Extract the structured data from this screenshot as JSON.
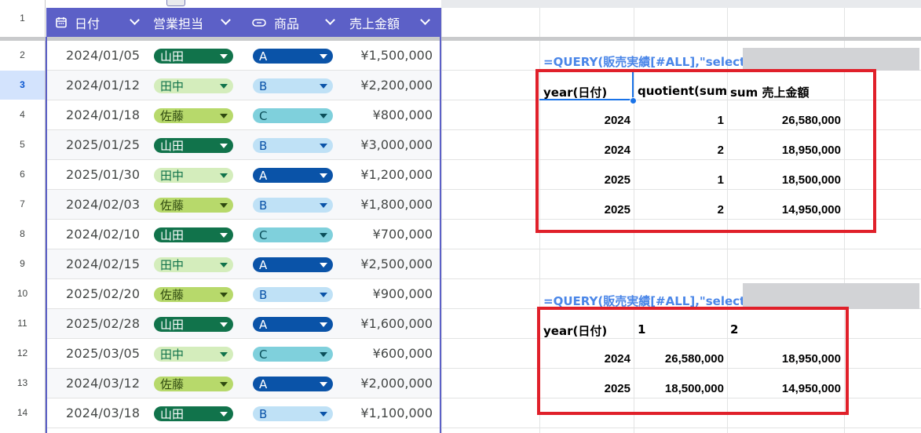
{
  "columns": [
    {
      "label": "日付",
      "icon": "calendar-icon"
    },
    {
      "label": "営業担当"
    },
    {
      "label": "商品",
      "icon": "chip-icon"
    },
    {
      "label": "売上金額"
    }
  ],
  "row_numbers": [
    "1",
    "2",
    "3",
    "4",
    "5",
    "6",
    "7",
    "8",
    "9",
    "10",
    "11",
    "12",
    "13",
    "14"
  ],
  "active_row": "3",
  "rows": [
    {
      "date": "2024/01/05",
      "person": "山田",
      "product": "A",
      "amount": "¥1,500,000"
    },
    {
      "date": "2024/01/12",
      "person": "田中",
      "product": "B",
      "amount": "¥2,200,000"
    },
    {
      "date": "2024/01/18",
      "person": "佐藤",
      "product": "C",
      "amount": "¥800,000"
    },
    {
      "date": "2025/01/25",
      "person": "山田",
      "product": "B",
      "amount": "¥3,000,000"
    },
    {
      "date": "2025/01/30",
      "person": "田中",
      "product": "A",
      "amount": "¥1,200,000"
    },
    {
      "date": "2024/02/03",
      "person": "佐藤",
      "product": "B",
      "amount": "¥1,800,000"
    },
    {
      "date": "2024/02/10",
      "person": "山田",
      "product": "C",
      "amount": "¥700,000"
    },
    {
      "date": "2024/02/15",
      "person": "田中",
      "product": "A",
      "amount": "¥2,500,000"
    },
    {
      "date": "2025/02/20",
      "person": "佐藤",
      "product": "B",
      "amount": "¥900,000"
    },
    {
      "date": "2025/02/28",
      "person": "山田",
      "product": "A",
      "amount": "¥1,600,000"
    },
    {
      "date": "2025/03/05",
      "person": "田中",
      "product": "C",
      "amount": "¥600,000"
    },
    {
      "date": "2024/03/12",
      "person": "佐藤",
      "product": "A",
      "amount": "¥2,000,000"
    },
    {
      "date": "2024/03/18",
      "person": "山田",
      "product": "B",
      "amount": "¥1,100,000"
    }
  ],
  "chip_colors": {
    "山田": {
      "bg": "#11734b",
      "fg": "#ffffff"
    },
    "田中": {
      "bg": "#d4edbc",
      "fg": "#11734b"
    },
    "佐藤": {
      "bg": "#b7d96b",
      "fg": "#2f4a10"
    },
    "A": {
      "bg": "#0a53a8",
      "fg": "#ffffff"
    },
    "B": {
      "bg": "#bfe1f6",
      "fg": "#0a53a8"
    },
    "C": {
      "bg": "#7fd0dc",
      "fg": "#0b4f5a"
    }
  },
  "header_bg": "#5c60c7",
  "query1": {
    "formula": "=QUERY(販売実績[#ALL],\"select",
    "headers": [
      "year(日付)",
      "quotient(sum(",
      "sum 売上金額"
    ],
    "rows": [
      [
        "2024",
        "1",
        "26,580,000"
      ],
      [
        "2024",
        "2",
        "18,950,000"
      ],
      [
        "2025",
        "1",
        "18,500,000"
      ],
      [
        "2025",
        "2",
        "14,950,000"
      ]
    ]
  },
  "query2": {
    "formula": "=QUERY(販売実績[#ALL],\"select",
    "headers": [
      "year(日付)",
      "1",
      "2"
    ],
    "rows": [
      [
        "2024",
        "26,580,000",
        "18,950,000"
      ],
      [
        "2025",
        "18,500,000",
        "14,950,000"
      ]
    ]
  },
  "highlight_color": "#e0202a",
  "formula_color": "#4a86e8"
}
